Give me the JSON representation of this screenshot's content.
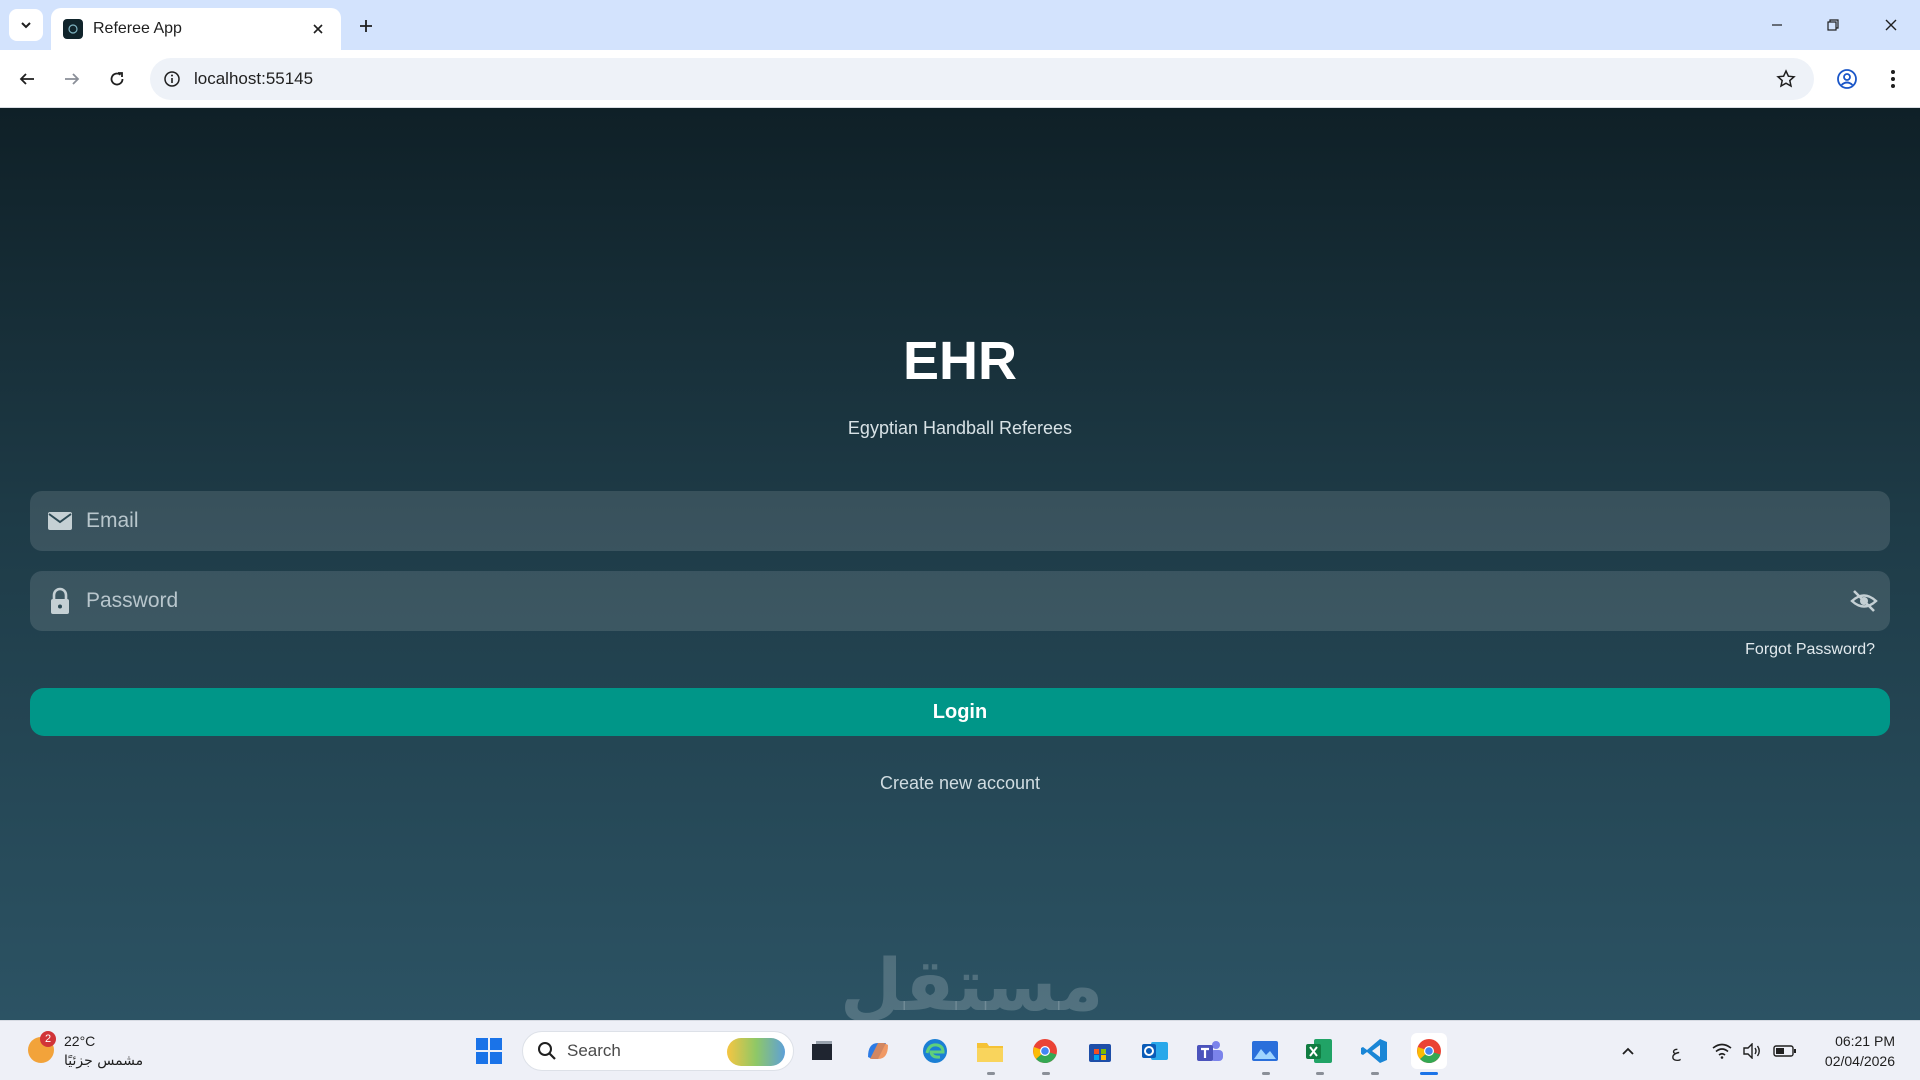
{
  "browser": {
    "tab_title": "Referee App",
    "url": "localhost:55145"
  },
  "app": {
    "title": "EHR",
    "subtitle": "Egyptian Handball Referees",
    "email_placeholder": "Email",
    "password_placeholder": "Password",
    "forgot_password": "Forgot Password?",
    "login_label": "Login",
    "create_account": "Create new account",
    "watermark": "مستقل",
    "colors": {
      "primary": "#009688",
      "background_top": "#0f2027",
      "background_bottom": "#2c5364"
    }
  },
  "taskbar": {
    "weather_temp": "22°C",
    "weather_condition": "مشمس جزئيًا",
    "weather_badge": "2",
    "search_label": "Search",
    "keyboard_lang": "ع",
    "time": "06:21 PM",
    "date": "02/04/2026",
    "apps": [
      "start-icon",
      "task-view-icon",
      "copilot-icon",
      "edge-icon",
      "file-explorer-icon",
      "chrome-icon",
      "store-icon",
      "outlook-icon",
      "teams-icon",
      "photos-icon",
      "excel-icon",
      "vscode-icon",
      "chrome-active-icon"
    ]
  }
}
